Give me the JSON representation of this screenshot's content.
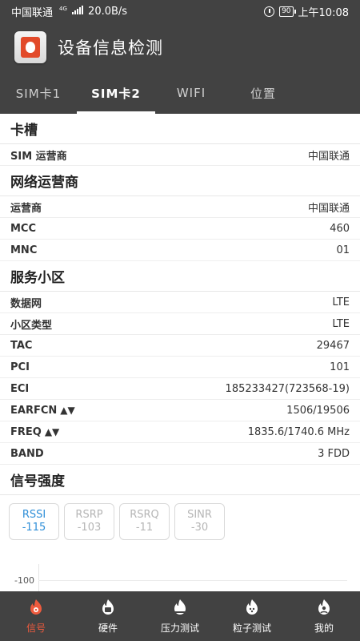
{
  "status_bar": {
    "carrier": "中国联通",
    "network_tag": "4G",
    "speed": "20.0B/s",
    "battery": "90",
    "time": "上午10:08"
  },
  "app": {
    "title": "设备信息检测",
    "icon": "device-fire-icon"
  },
  "tabs": [
    {
      "label": "SIM卡1",
      "active": false
    },
    {
      "label": "SIM卡2",
      "active": true
    },
    {
      "label": "WIFI",
      "active": false
    },
    {
      "label": "位置",
      "active": false
    }
  ],
  "sections": {
    "slot": {
      "title": "卡槽",
      "rows": [
        {
          "label": "SIM 运营商",
          "value": "中国联通"
        }
      ]
    },
    "network": {
      "title": "网络运营商",
      "rows": [
        {
          "label": "运营商",
          "value": "中国联通"
        },
        {
          "label": "MCC",
          "value": "460"
        },
        {
          "label": "MNC",
          "value": "01"
        }
      ]
    },
    "cell": {
      "title": "服务小区",
      "rows": [
        {
          "label": "数据网",
          "value": "LTE"
        },
        {
          "label": "小区类型",
          "value": "LTE"
        },
        {
          "label": "TAC",
          "value": "29467"
        },
        {
          "label": "PCI",
          "value": "101"
        },
        {
          "label": "ECI",
          "value": "185233427(723568-19)"
        },
        {
          "label": "EARFCN",
          "arrows": "▲▼",
          "value": "1506/19506"
        },
        {
          "label": "FREQ",
          "arrows": "▲▼",
          "value": "1835.6/1740.6 MHz"
        },
        {
          "label": "BAND",
          "value": "3 FDD"
        }
      ]
    },
    "signal": {
      "title": "信号强度",
      "metrics": [
        {
          "name": "RSSI",
          "value": "-115",
          "active": true
        },
        {
          "name": "RSRP",
          "value": "-103",
          "active": false
        },
        {
          "name": "RSRQ",
          "value": "-11",
          "active": false
        },
        {
          "name": "SINR",
          "value": "-30",
          "active": false
        }
      ],
      "chart_y_tick": "-100"
    }
  },
  "bottom_nav": [
    {
      "label": "信号",
      "icon": "signal-icon",
      "active": true
    },
    {
      "label": "硬件",
      "icon": "hardware-icon",
      "active": false
    },
    {
      "label": "压力测试",
      "icon": "stress-test-icon",
      "active": false
    },
    {
      "label": "粒子测试",
      "icon": "particle-test-icon",
      "active": false
    },
    {
      "label": "我的",
      "icon": "profile-icon",
      "active": false
    }
  ],
  "colors": {
    "bar_bg": "#424242",
    "accent_active_nav": "#ef5b3e",
    "accent_metric": "#2f8fd8"
  }
}
